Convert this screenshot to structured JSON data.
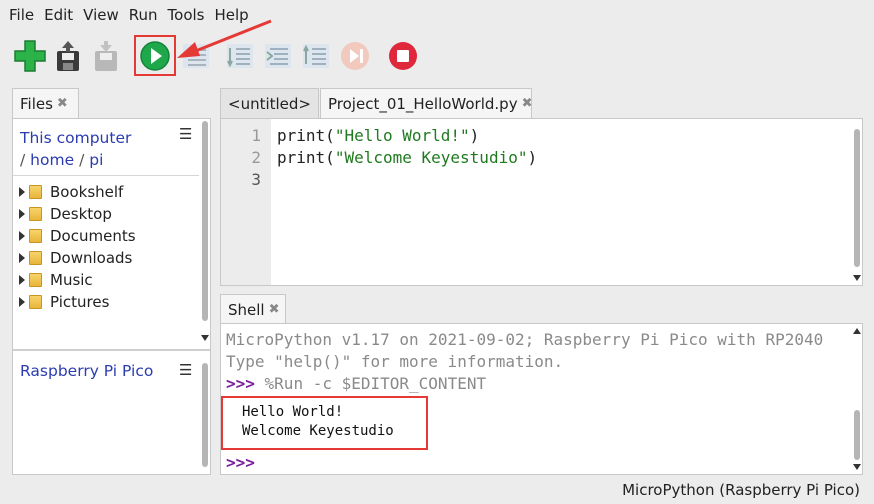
{
  "menu": [
    "File",
    "Edit",
    "View",
    "Run",
    "Tools",
    "Help"
  ],
  "toolbar": [
    {
      "icon": "new-file-icon",
      "enabled": true
    },
    {
      "icon": "load-icon",
      "enabled": true
    },
    {
      "icon": "save-icon",
      "enabled": false
    },
    {
      "icon": "run-icon",
      "enabled": true,
      "highlighted": true
    },
    {
      "icon": "debug-icon",
      "enabled": false
    },
    {
      "icon": "step-over-icon",
      "enabled": false
    },
    {
      "icon": "step-into-icon",
      "enabled": false
    },
    {
      "icon": "step-out-icon",
      "enabled": false
    },
    {
      "icon": "resume-icon",
      "enabled": false
    },
    {
      "icon": "stop-icon",
      "enabled": true
    }
  ],
  "files": {
    "tab_label": "Files",
    "location": "This computer",
    "path_sep": "/",
    "path": [
      "home",
      "pi"
    ],
    "folders": [
      "Bookshelf",
      "Desktop",
      "Documents",
      "Downloads",
      "Music",
      "Pictures"
    ],
    "device_label": "Raspberry Pi Pico"
  },
  "editor": {
    "tabs": [
      "<untitled>",
      "Project_01_HelloWorld.py"
    ],
    "lines": [
      {
        "num": "1",
        "func": "print",
        "arg": "\"Hello World!\""
      },
      {
        "num": "2",
        "func": "print",
        "arg": "\"Welcome Keyestudio\""
      },
      {
        "num": "3",
        "func": "",
        "arg": ""
      }
    ]
  },
  "shell": {
    "tab_label": "Shell",
    "banner": "MicroPython v1.17 on 2021-09-02; Raspberry Pi Pico with RP2040",
    "help": "Type \"help()\" for more information.",
    "prompt": ">>>",
    "command": " %Run -c $EDITOR_CONTENT",
    "output": [
      "Hello World!",
      "Welcome Keyestudio"
    ]
  },
  "status": {
    "interpreter": "MicroPython (Raspberry Pi Pico)"
  },
  "colors": {
    "highlight": "#e53935",
    "run_green": "#1ea84b",
    "stop_red": "#e0283c"
  }
}
